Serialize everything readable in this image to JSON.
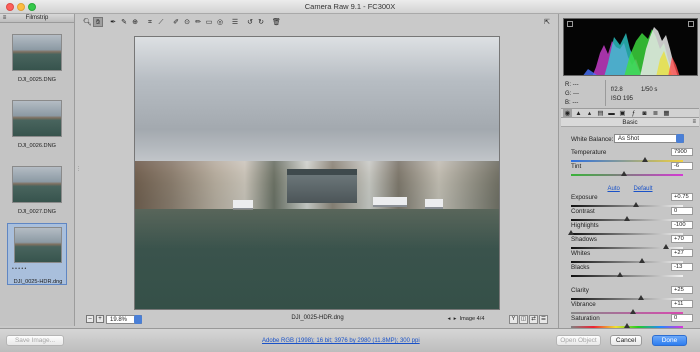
{
  "window": {
    "title": "Camera Raw 9.1  -  FC300X"
  },
  "filmstrip": {
    "title": "Filmstrip",
    "items": [
      {
        "name": "DJI_0025.DNG"
      },
      {
        "name": "DJI_0026.DNG"
      },
      {
        "name": "DJI_0027.DNG"
      },
      {
        "name": "DJI_0025-HDR.dng",
        "selected": true,
        "rating_dots": "• • • • •"
      }
    ]
  },
  "toolbar": {
    "tools": [
      "zoom-tool",
      "hand-tool",
      "white-balance-tool",
      "color-sampler-tool",
      "targeted-adjustment-tool",
      "crop-tool",
      "straighten-tool",
      "spot-removal-tool",
      "red-eye-tool",
      "adjustment-brush-tool",
      "graduated-filter-tool",
      "radial-filter-tool",
      "preferences",
      "rotate-left",
      "rotate-right",
      "trash"
    ],
    "active_tool": "hand-tool"
  },
  "preview": {
    "filename": "DJI_0025-HDR.dng",
    "zoom": "19.8%",
    "image_counter": "Image 4/4"
  },
  "histogram": {
    "rgb_labels": [
      "R:",
      "G:",
      "B:"
    ],
    "rgb_values": [
      "---",
      "---",
      "---"
    ],
    "aperture": "f/2.8",
    "shutter": "1/50 s",
    "iso": "ISO 195"
  },
  "panel": {
    "section_title": "Basic",
    "white_balance_label": "White Balance:",
    "white_balance_value": "As Shot",
    "auto_label": "Auto",
    "default_label": "Default",
    "sliders": [
      {
        "label": "Temperature",
        "value": "7900",
        "position": 0.66
      },
      {
        "label": "Tint",
        "value": "-6",
        "position": 0.47
      },
      {
        "label": "Exposure",
        "value": "+0.75",
        "position": 0.58
      },
      {
        "label": "Contrast",
        "value": "0",
        "position": 0.5
      },
      {
        "label": "Highlights",
        "value": "-100",
        "position": 0.0
      },
      {
        "label": "Shadows",
        "value": "+70",
        "position": 0.85
      },
      {
        "label": "Whites",
        "value": "+27",
        "position": 0.635
      },
      {
        "label": "Blacks",
        "value": "-13",
        "position": 0.435
      },
      {
        "label": "Clarity",
        "value": "+25",
        "position": 0.625
      },
      {
        "label": "Vibrance",
        "value": "+11",
        "position": 0.555
      },
      {
        "label": "Saturation",
        "value": "0",
        "position": 0.5
      }
    ]
  },
  "bottom": {
    "save_label": "Save Image...",
    "workflow_link": "Adobe RGB (1998); 16 bit; 3976 by 2980 (11.8MP); 300 ppi",
    "open_label": "Open Object",
    "cancel_label": "Cancel",
    "done_label": "Done"
  }
}
